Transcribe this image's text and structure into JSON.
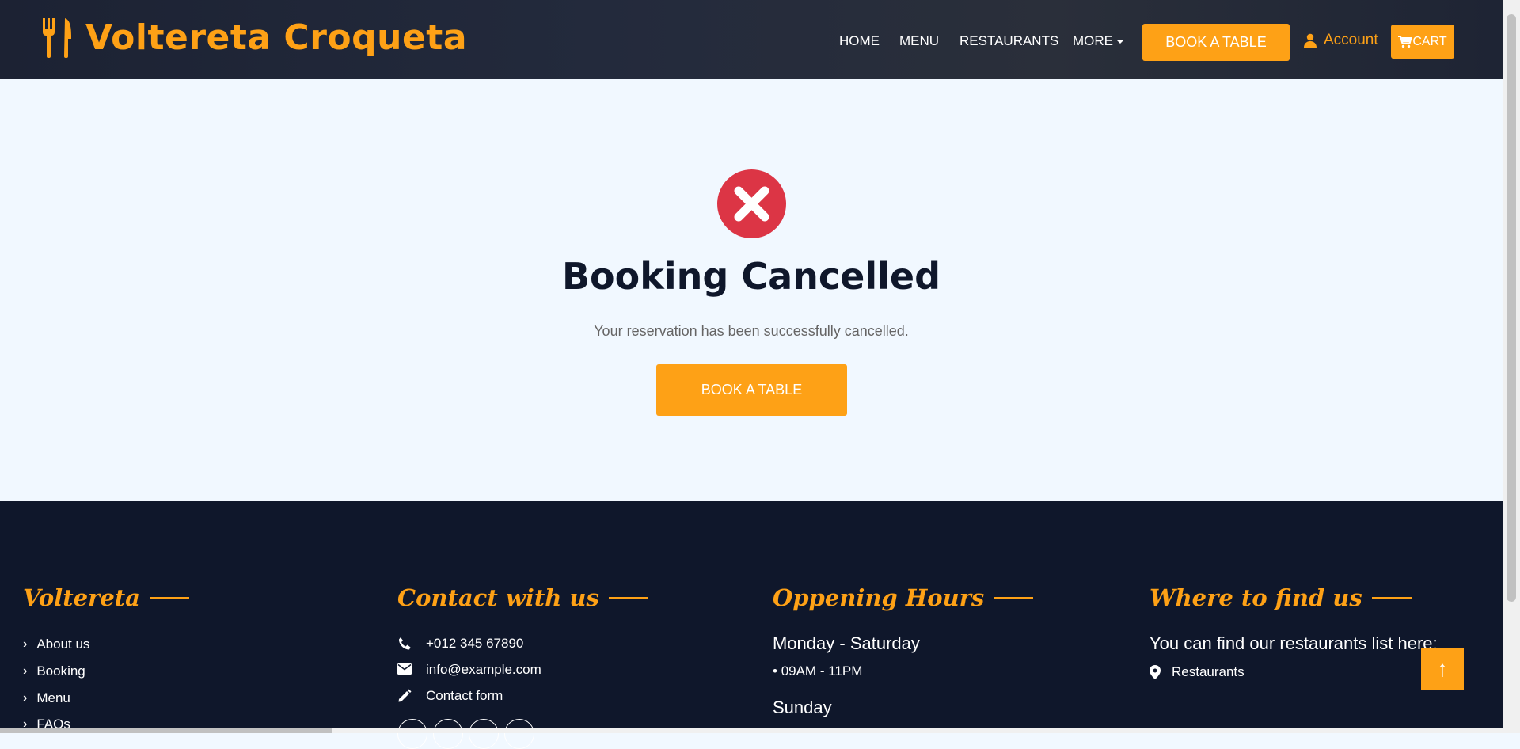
{
  "header": {
    "brand_name": "Voltereta Croqueta",
    "nav": {
      "home": "HOME",
      "menu": "MENU",
      "restaurants": "RESTAURANTS",
      "more": "MORE"
    },
    "book_button": "BOOK A TABLE",
    "account_label": "Account",
    "cart_label": "CART"
  },
  "main": {
    "title": "Booking Cancelled",
    "message": "Your reservation has been successfully cancelled.",
    "cta_button": "BOOK A TABLE",
    "status_icon": "x-circle-icon"
  },
  "footer": {
    "col1": {
      "title": "Voltereta",
      "links": [
        "About us",
        "Booking",
        "Menu",
        "FAQs"
      ]
    },
    "col2": {
      "title": "Contact with us",
      "phone": "+012 345 67890",
      "email": "info@example.com",
      "contact_form": "Contact form"
    },
    "col3": {
      "title": "Oppening Hours",
      "weekday_label": "Monday - Saturday",
      "weekday_hours": "09AM - 11PM",
      "sunday_label": "Sunday"
    },
    "col4": {
      "title": "Where to find us",
      "text": "You can find our restaurants list here:",
      "link": "Restaurants"
    }
  },
  "colors": {
    "accent": "#fea116",
    "dark": "#0f172b",
    "danger": "#dc3545",
    "background": "#f1f8ff"
  }
}
